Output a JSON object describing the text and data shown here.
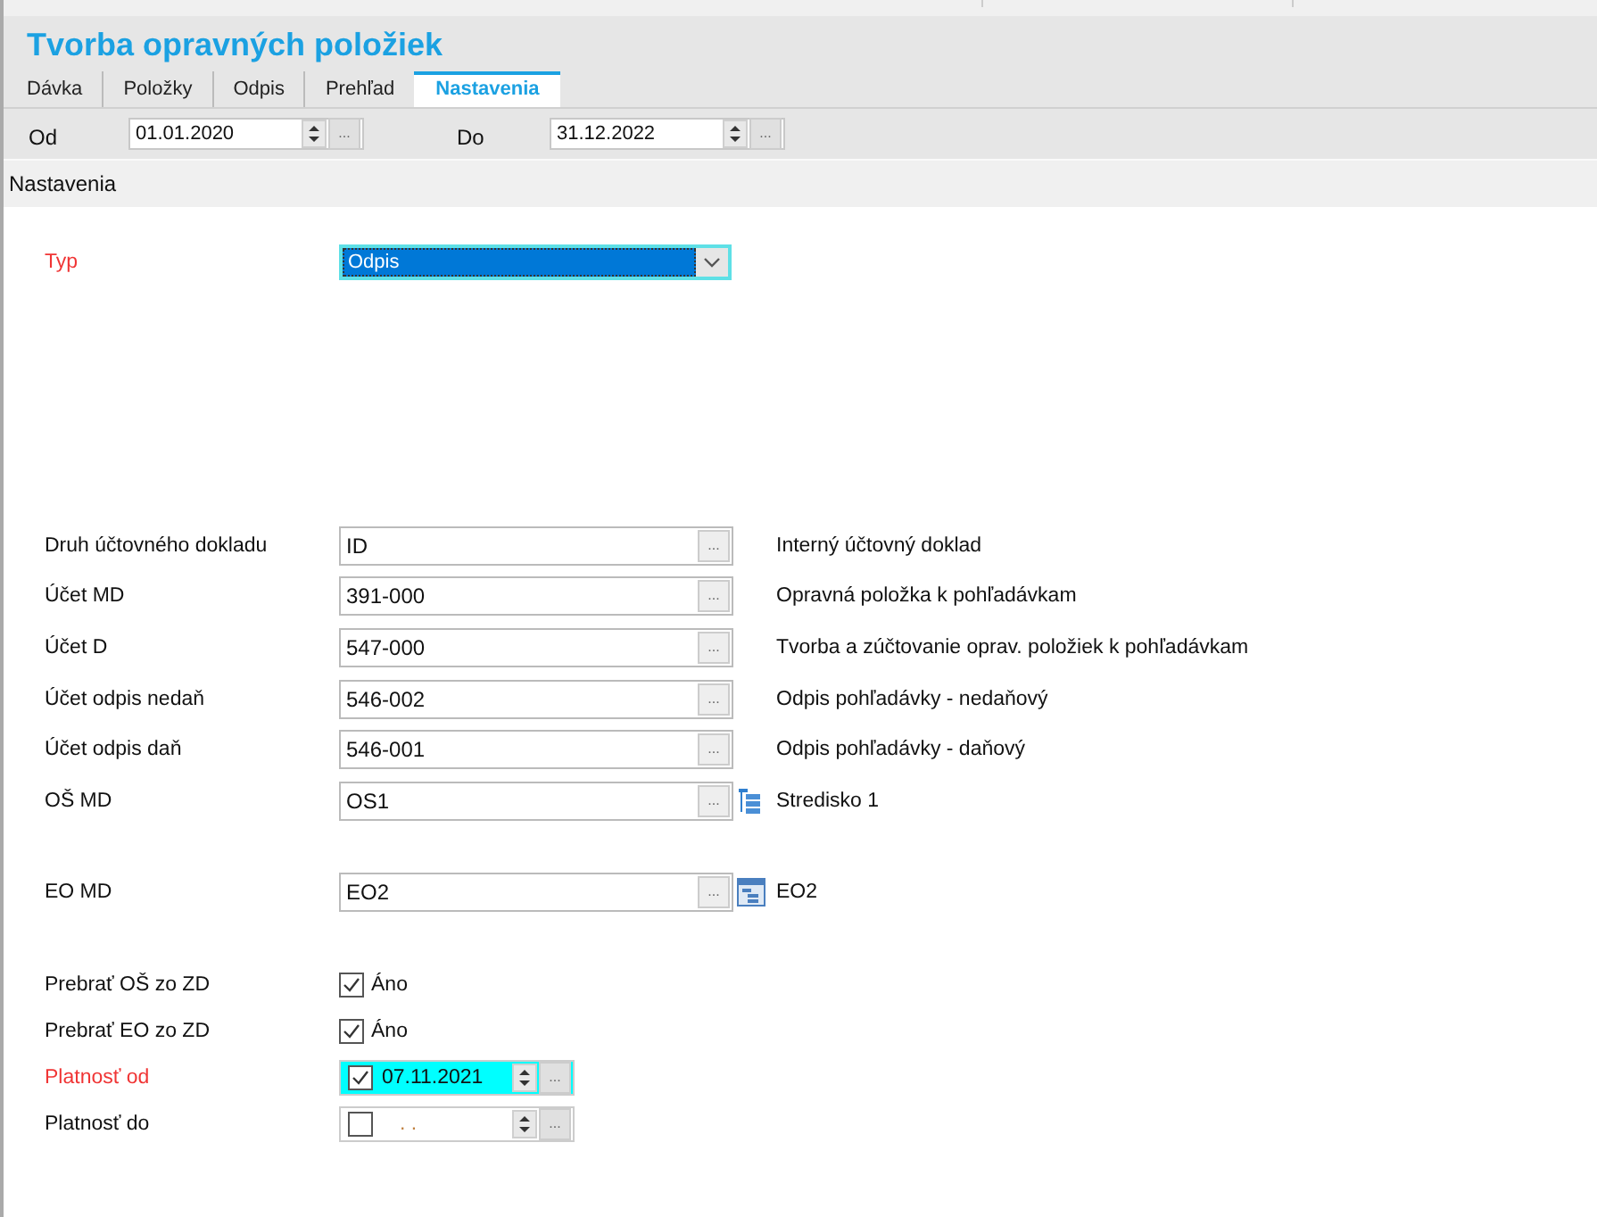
{
  "title": "Tvorba opravných položiek",
  "tabs": [
    {
      "label": "Dávka",
      "selected": false
    },
    {
      "label": "Položky",
      "selected": false
    },
    {
      "label": "Odpis",
      "selected": false
    },
    {
      "label": "Prehľad",
      "selected": false
    },
    {
      "label": "Nastavenia",
      "selected": true
    }
  ],
  "date_range": [
    {
      "label": "Od",
      "value": "01.01.2020",
      "button": "..."
    },
    {
      "label": "Do",
      "value": "31.12.2022",
      "button": "..."
    }
  ],
  "section_title": "Nastavenia",
  "type_field": {
    "label": "Typ",
    "required": true,
    "value": "Odpis",
    "focused": true
  },
  "account_fields": [
    {
      "label": "Druh účtovného dokladu",
      "value": "ID",
      "button": "...",
      "kind": "plain",
      "description": "Interný účtovný doklad"
    },
    {
      "label": "Účet MD",
      "value": "391-000",
      "button": "...",
      "kind": "plain",
      "description": "Opravná položka k pohľadávkam"
    },
    {
      "label": "Účet D",
      "value": "547-000",
      "button": "...",
      "kind": "plain",
      "description": "Tvorba a zúčtovanie oprav. položiek k pohľadávkam"
    },
    {
      "label": "Účet odpis nedaň",
      "value": "546-002",
      "button": "...",
      "kind": "plain",
      "description": "Odpis pohľadávky - nedaňový"
    },
    {
      "label": "Účet odpis daň",
      "value": "546-001",
      "button": "...",
      "kind": "plain",
      "description": "Odpis pohľadávky - daňový"
    },
    {
      "label": "OŠ MD",
      "value": "OS1",
      "button": "...",
      "kind": "tree",
      "description": "Stredisko 1"
    }
  ],
  "cost_object_fields": [
    {
      "label": "EO MD",
      "value": "EO2",
      "button": "...",
      "kind": "grid",
      "description": "EO2"
    }
  ],
  "checkbox_fields": [
    {
      "label": "Prebrať OŠ zo ZD",
      "checked": true,
      "text": "Áno"
    },
    {
      "label": "Prebrať EO zo ZD",
      "checked": true,
      "text": "Áno"
    }
  ],
  "validity_fields": [
    {
      "label": "Platnosť od",
      "required": true,
      "checked": true,
      "focused": true,
      "value": "07.11.2021",
      "button": "..."
    },
    {
      "label": "Platnosť do",
      "required": false,
      "checked": false,
      "focused": false,
      "value": ".  .",
      "button": "..."
    }
  ]
}
